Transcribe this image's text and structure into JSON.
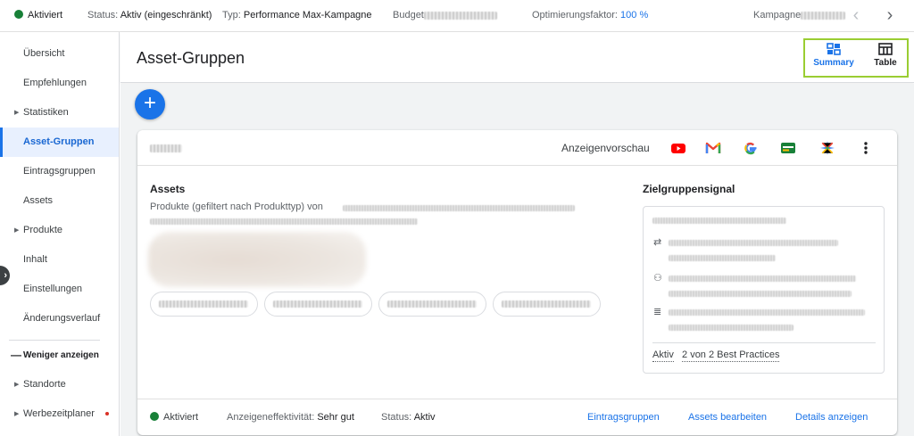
{
  "topbar": {
    "state": "Aktiviert",
    "status_label": "Status:",
    "status_value": "Aktiv (eingeschränkt)",
    "type_label": "Typ:",
    "type_value": "Performance Max-Kampagne",
    "budget_label": "Budget",
    "optimization_label": "Optimierungsfaktor:",
    "optimization_value": "100 %",
    "campaign_label": "Kampagne"
  },
  "sidebar": {
    "items": [
      {
        "label": "Übersicht"
      },
      {
        "label": "Empfehlungen"
      },
      {
        "label": "Statistiken"
      },
      {
        "label": "Asset-Gruppen"
      },
      {
        "label": "Eintragsgruppen"
      },
      {
        "label": "Assets"
      },
      {
        "label": "Produkte"
      },
      {
        "label": "Inhalt"
      },
      {
        "label": "Einstellungen"
      },
      {
        "label": "Änderungsverlauf"
      }
    ],
    "show_less": "Weniger anzeigen",
    "extra": [
      {
        "label": "Standorte"
      },
      {
        "label": "Werbezeitplaner"
      }
    ]
  },
  "header": {
    "title": "Asset-Gruppen",
    "views": {
      "summary": "Summary",
      "table": "Table"
    }
  },
  "card": {
    "preview_label": "Anzeigenvorschau",
    "channel_icons": [
      "youtube-icon",
      "gmail-icon",
      "google-search-icon",
      "display-icon",
      "discover-icon"
    ],
    "assets_title": "Assets",
    "assets_sub": "Produkte (gefiltert nach Produkttyp) von",
    "audience_title": "Zielgruppensignal",
    "audience_status": "Aktiv",
    "best_practices": "2 von 2 Best Practices",
    "footer": {
      "state": "Aktiviert",
      "effectiveness_label": "Anzeigeneffektivität:",
      "effectiveness_value": "Sehr gut",
      "status_label": "Status:",
      "status_value": "Aktiv",
      "links": [
        "Eintragsgruppen",
        "Assets bearbeiten",
        "Details anzeigen"
      ]
    }
  },
  "colors": {
    "accent": "#1a73e8",
    "active_green": "#188038",
    "highlight_border": "#9acd32"
  }
}
